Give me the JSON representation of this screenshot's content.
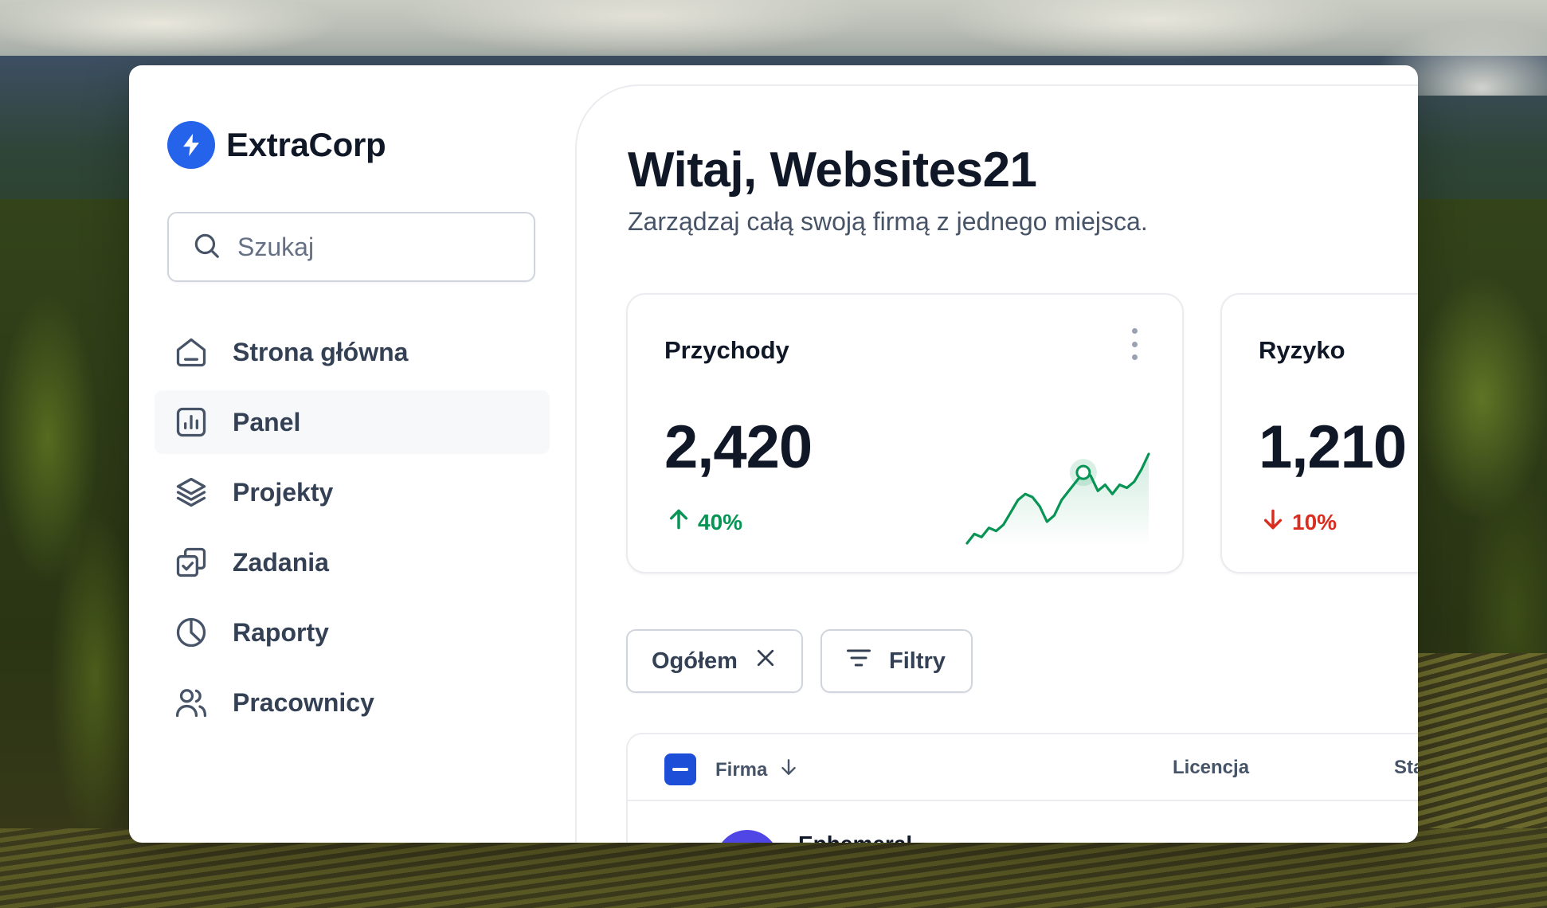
{
  "brand": {
    "name": "ExtraCorp",
    "accent": "#2563eb",
    "icon": "lightning-bolt-icon"
  },
  "search": {
    "placeholder": "Szukaj",
    "icon": "search-icon"
  },
  "nav": [
    {
      "label": "Strona główna",
      "icon": "home-icon",
      "active": false
    },
    {
      "label": "Panel",
      "icon": "bar-chart-icon",
      "active": true
    },
    {
      "label": "Projekty",
      "icon": "layers-icon",
      "active": false
    },
    {
      "label": "Zadania",
      "icon": "check-square-icon",
      "active": false
    },
    {
      "label": "Raporty",
      "icon": "pie-chart-icon",
      "active": false
    },
    {
      "label": "Pracownicy",
      "icon": "users-icon",
      "active": false
    }
  ],
  "main": {
    "title": "Witaj, Websites21",
    "subtitle": "Zarządzaj całą swoją firmą z jednego miejsca."
  },
  "metrics": [
    {
      "title": "Przychody",
      "value": "2,420",
      "change": "40%",
      "direction": "up",
      "color": "#079455"
    },
    {
      "title": "Ryzyko",
      "value": "1,210",
      "change": "10%",
      "direction": "down",
      "color": "#d92d20"
    }
  ],
  "sparkline": {
    "values": [
      2,
      5,
      4,
      7,
      6,
      8,
      12,
      16,
      18,
      17,
      14,
      9,
      11,
      16,
      19,
      22,
      25,
      24,
      19,
      21,
      18,
      21,
      20,
      22,
      26,
      31
    ],
    "highlight_index": 16,
    "color": "#079455"
  },
  "filters": {
    "overall": "Ogółem",
    "filters": "Filtry"
  },
  "table": {
    "columns": [
      "Firma",
      "Licencja",
      "Sta"
    ],
    "rows": [
      {
        "name": "Ephemeral"
      }
    ]
  }
}
